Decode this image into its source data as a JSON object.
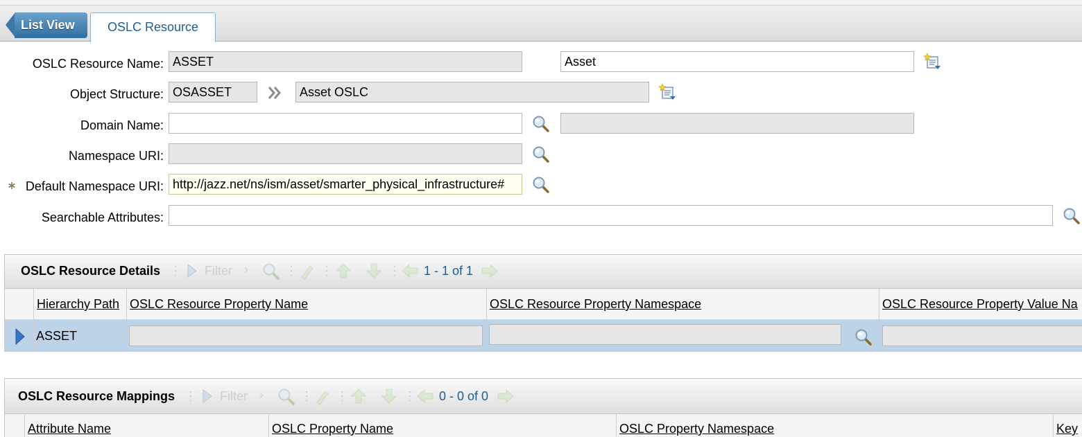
{
  "nav": {
    "list_view_label": "List View",
    "active_tab": "OSLC Resource"
  },
  "form": {
    "resource_name_label": "OSLC Resource Name:",
    "resource_name_value": "ASSET",
    "resource_desc_value": "Asset",
    "object_structure_label": "Object Structure:",
    "object_structure_value": "OSASSET",
    "object_structure_desc": "Asset OSLC",
    "domain_name_label": "Domain Name:",
    "domain_name_value": "",
    "domain_desc_value": "",
    "namespace_uri_label": "Namespace URI:",
    "namespace_uri_value": "",
    "default_ns_label": "Default Namespace URI:",
    "default_ns_value": "http://jazz.net/ns/ism/asset/smarter_physical_infrastructure#",
    "searchable_label": "Searchable Attributes:",
    "searchable_value": ""
  },
  "details": {
    "title": "OSLC Resource Details",
    "filter_label": "Filter",
    "pagination": "1 - 1 of 1",
    "columns": [
      "Hierarchy Path",
      "OSLC Resource Property Name",
      "OSLC Resource Property Namespace",
      "OSLC Resource Property Value Na"
    ],
    "rows": [
      {
        "hierarchy_path": "ASSET"
      }
    ]
  },
  "mappings": {
    "title": "OSLC Resource Mappings",
    "filter_label": "Filter",
    "pagination": "0 - 0 of 0",
    "columns": [
      "Attribute Name",
      "OSLC Property Name",
      "OSLC Property Namespace",
      "Key"
    ]
  },
  "colors": {
    "accent": "#1d5d91",
    "row_selected": "#bcd3e8",
    "required_field": "#fffff0"
  },
  "icons": [
    "long-description-icon",
    "detail-menu-icon",
    "magnifier-icon",
    "filter-arrow-icon",
    "previous-page-icon",
    "next-page-icon",
    "required-asterisk-icon"
  ]
}
